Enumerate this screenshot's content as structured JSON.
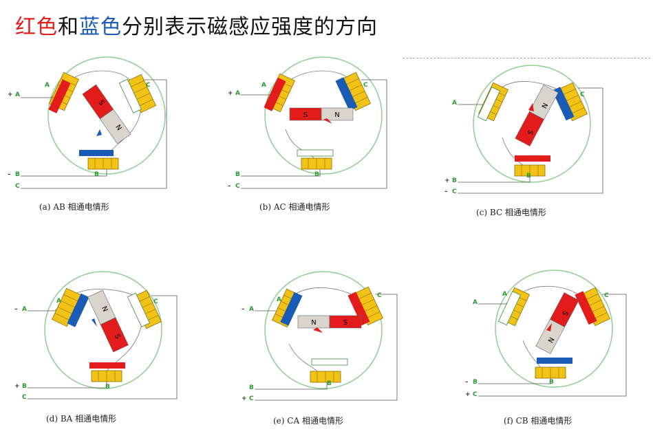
{
  "title": {
    "part1": "红色",
    "part2": "和",
    "part3": "蓝色",
    "part4": "分别表示磁感应强度的方向"
  },
  "colors": {
    "red": "#e21b1b",
    "blue": "#1a5bb5",
    "circle": "#8fcf8f",
    "coil": "#f2c316",
    "magnet_gray": "#d9d4cc"
  },
  "panels": [
    {
      "caption": "(a) AB 相通电情形",
      "A": "A",
      "B": "B",
      "C": "C",
      "a_sign": "+",
      "b_sign": "–",
      "c_sign": "",
      "magnet_N": "N",
      "magnet_S": "S"
    },
    {
      "caption": "(b) AC 相通电情形",
      "A": "A",
      "B": "B",
      "C": "C",
      "a_sign": "+",
      "b_sign": "",
      "c_sign": "–",
      "magnet_N": "N",
      "magnet_S": "S"
    },
    {
      "caption": "(c) BC 相通电情形",
      "A": "A",
      "B": "B",
      "C": "C",
      "a_sign": "",
      "b_sign": "+",
      "c_sign": "–",
      "magnet_N": "N",
      "magnet_S": "S"
    },
    {
      "caption": "(d) BA  相通电情形",
      "A": "A",
      "B": "B",
      "C": "C",
      "a_sign": "–",
      "b_sign": "+",
      "c_sign": "",
      "magnet_N": "N",
      "magnet_S": "S"
    },
    {
      "caption": "(e) CA  相通电情形",
      "A": "A",
      "B": "B",
      "C": "C",
      "a_sign": "–",
      "b_sign": "",
      "c_sign": "+",
      "magnet_N": "N",
      "magnet_S": "S"
    },
    {
      "caption": "(f) CB 相通电情形",
      "A": "A",
      "B": "B",
      "C": "C",
      "a_sign": "",
      "b_sign": "–",
      "c_sign": "+",
      "magnet_N": "N",
      "magnet_S": "S"
    }
  ]
}
